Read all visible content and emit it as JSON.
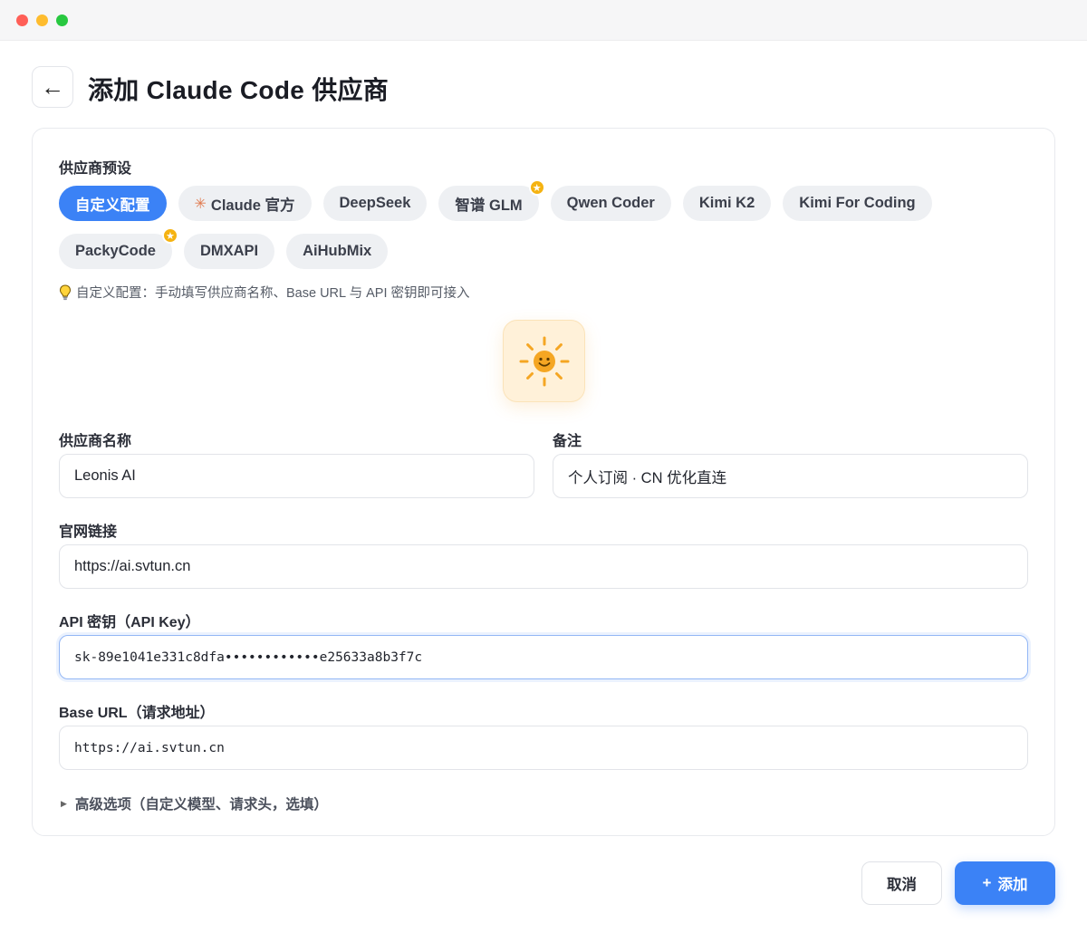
{
  "window": {
    "title": "添加 Claude Code 供应商"
  },
  "presets": {
    "label": "供应商预设",
    "items": [
      {
        "label": "自定义配置",
        "active": true,
        "badge": false,
        "asterisk": false
      },
      {
        "label": "Claude 官方",
        "active": false,
        "badge": false,
        "asterisk": true
      },
      {
        "label": "DeepSeek",
        "active": false,
        "badge": false,
        "asterisk": false
      },
      {
        "label": "智谱 GLM",
        "active": false,
        "badge": true,
        "asterisk": false
      },
      {
        "label": "Qwen Coder",
        "active": false,
        "badge": false,
        "asterisk": false
      },
      {
        "label": "Kimi K2",
        "active": false,
        "badge": false,
        "asterisk": false
      },
      {
        "label": "Kimi For Coding",
        "active": false,
        "badge": false,
        "asterisk": false
      },
      {
        "label": "PackyCode",
        "active": false,
        "badge": true,
        "asterisk": false
      },
      {
        "label": "DMXAPI",
        "active": false,
        "badge": false,
        "asterisk": false
      },
      {
        "label": "AiHubMix",
        "active": false,
        "badge": false,
        "asterisk": false
      }
    ],
    "hint": "自定义配置：手动填写供应商名称、Base URL 与 API 密钥即可接入"
  },
  "form": {
    "name_label": "供应商名称",
    "name_value": "Leonis AI",
    "note_label": "备注",
    "note_value": "个人订阅 · CN 优化直连",
    "website_label": "官网链接",
    "website_value": "https://ai.svtun.cn",
    "apikey_label": "API 密钥（API Key）",
    "apikey_value": "sk-89e1041e331c8dfa••••••••••••e25633a8b3f7c",
    "baseurl_label": "Base URL（请求地址）",
    "baseurl_value": "https://ai.svtun.cn",
    "advanced_label": "高级选项（自定义模型、请求头，选填）"
  },
  "footer": {
    "cancel_label": "取消",
    "add_label": "添加"
  },
  "colors": {
    "accent": "#3b82f6",
    "badge": "#f5b312",
    "logo_bg": "#fff1d9",
    "sun": "#f5a623"
  },
  "icons": {
    "back": "arrow-left-icon",
    "badge": "star-icon",
    "hint": "lightbulb-icon",
    "logo": "smiling-sun-icon",
    "advanced": "caret-right-icon",
    "add": "plus-icon"
  }
}
